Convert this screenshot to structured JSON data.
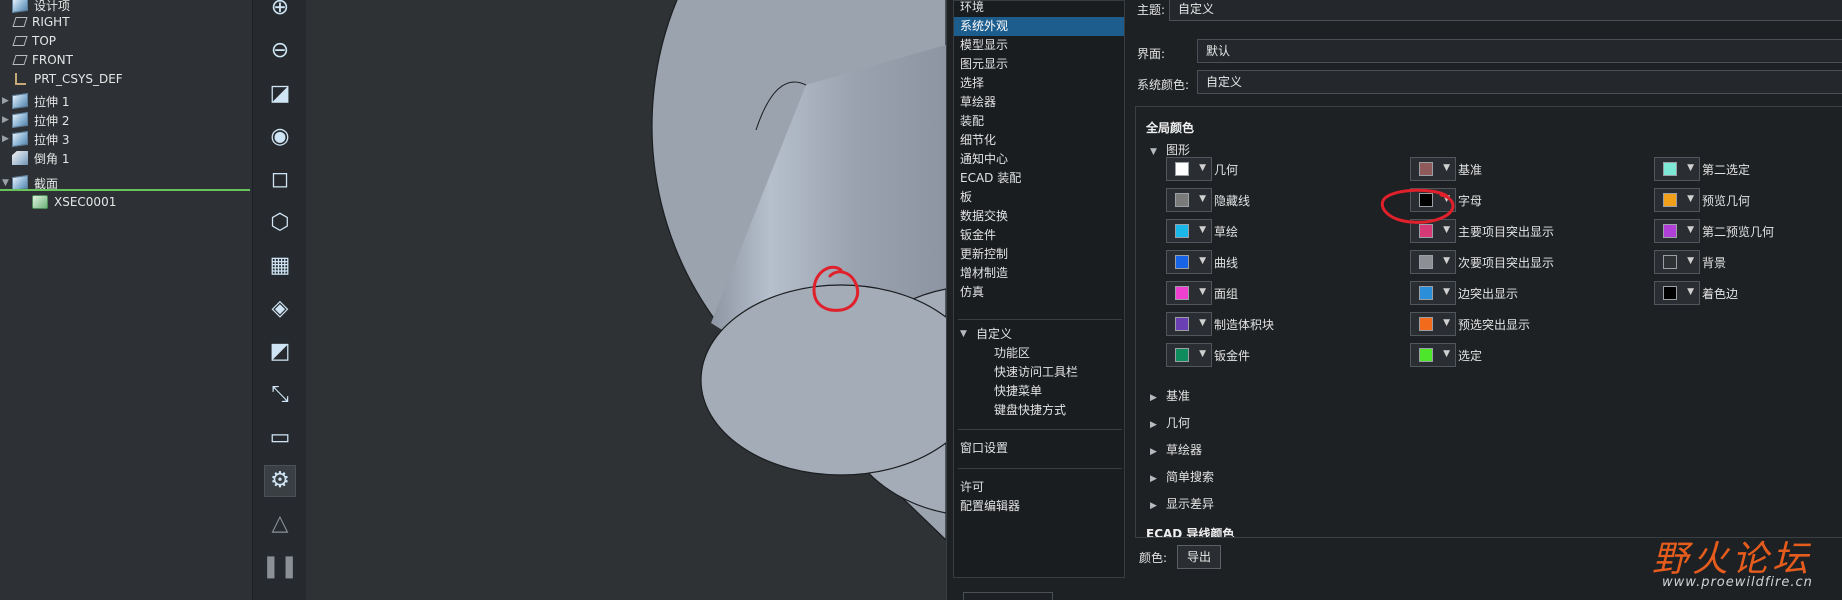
{
  "tree": {
    "items": [
      {
        "label": "设计项",
        "icon": "part-icon",
        "arrow": ""
      },
      {
        "label": "RIGHT",
        "icon": "datum-plane-icon",
        "arrow": ""
      },
      {
        "label": "TOP",
        "icon": "datum-plane-icon",
        "arrow": ""
      },
      {
        "label": "FRONT",
        "icon": "datum-plane-icon",
        "arrow": ""
      },
      {
        "label": "PRT_CSYS_DEF",
        "icon": "coordinate-system-icon",
        "arrow": ""
      },
      {
        "label": "拉伸 1",
        "icon": "extrude-icon",
        "arrow": "▶"
      },
      {
        "label": "拉伸 2",
        "icon": "extrude-icon",
        "arrow": "▶"
      },
      {
        "label": "拉伸 3",
        "icon": "extrude-icon",
        "arrow": "▶"
      },
      {
        "label": "倒角 1",
        "icon": "chamfer-icon",
        "arrow": ""
      },
      {
        "label": "截面",
        "icon": "section-folder-icon",
        "arrow": "▼"
      },
      {
        "label": "XSEC0001",
        "icon": "cross-section-icon",
        "arrow": ""
      }
    ]
  },
  "toolbar": {
    "icons": [
      "zoom-in-icon",
      "zoom-out-icon",
      "refit-icon",
      "display-style-icon",
      "saved-views-icon",
      "view-manager-icon",
      "annotation-table-icon",
      "perspective-icon",
      "section-view-icon",
      "datum-display-icon",
      "appearance-icon",
      "flexible-modeling-icon",
      "triangle-icon",
      "pause-icon",
      "spin-center-icon"
    ]
  },
  "nav": {
    "items": [
      "环境",
      "系统外观",
      "模型显示",
      "图元显示",
      "选择",
      "草绘器",
      "装配",
      "细节化",
      "通知中心",
      "ECAD 装配",
      "板",
      "数据交换",
      "钣金件",
      "更新控制",
      "增材制造",
      "仿真"
    ],
    "selected": "系统外观",
    "customize_group": "自定义",
    "customize_items": [
      "功能区",
      "快速访问工具栏",
      "快捷菜单",
      "键盘快捷方式"
    ],
    "window_settings": "窗口设置",
    "license": "许可",
    "config_editor": "配置编辑器"
  },
  "props": {
    "theme_label": "主题:",
    "theme_value": "自定义",
    "interface_label": "界面:",
    "interface_value": "默认",
    "syscolor_label": "系统颜色:",
    "syscolor_value": "自定义"
  },
  "global_colors": {
    "title": "全局颜色",
    "graphics_group": "图形",
    "columns": [
      [
        {
          "label": "几何",
          "color": "#ffffff"
        },
        {
          "label": "隐藏线",
          "color": "#7a7a7a"
        },
        {
          "label": "草绘",
          "color": "#1ab8e8"
        },
        {
          "label": "曲线",
          "color": "#1764e6"
        },
        {
          "label": "面组",
          "color": "#ee3fd0"
        },
        {
          "label": "制造体积块",
          "color": "#6a3fb3"
        },
        {
          "label": "钣金件",
          "color": "#0f8c5e"
        }
      ],
      [
        {
          "label": "基准",
          "color": "#8f5a5a"
        },
        {
          "label": "字母",
          "color": "#000000"
        },
        {
          "label": "主要项目突出显示",
          "color": "#d63a74"
        },
        {
          "label": "次要项目突出显示",
          "color": "#8c8f93"
        },
        {
          "label": "边突出显示",
          "color": "#2a8ed8"
        },
        {
          "label": "预选突出显示",
          "color": "#f26a1b"
        },
        {
          "label": "选定",
          "color": "#4ee62b"
        }
      ],
      [
        {
          "label": "第二选定",
          "color": "#7de8d6"
        },
        {
          "label": "预览几何",
          "color": "#f2a019"
        },
        {
          "label": "第二预览几何",
          "color": "#b040d8"
        },
        {
          "label": "背景",
          "color": "#2e3235"
        },
        {
          "label": "着色边",
          "color": "#000000"
        }
      ]
    ],
    "collapsed_groups": [
      "基准",
      "几何",
      "草绘器",
      "简单搜索",
      "显示差异"
    ],
    "next_section": "ECAD 导线颜色"
  },
  "footer": {
    "color_label": "颜色:",
    "export_label": "导出"
  },
  "watermark": {
    "text": "野火论坛",
    "url": "www.proewildfire.cn"
  },
  "annotation_color": "#e0202a"
}
